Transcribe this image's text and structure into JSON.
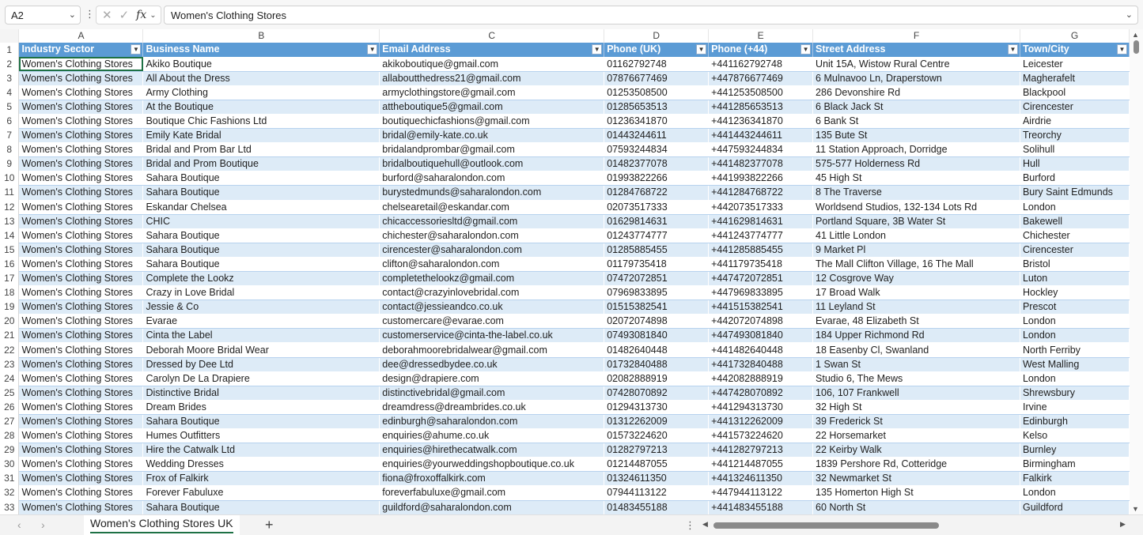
{
  "name_box": "A2",
  "formula_value": "Women's Clothing Stores",
  "columns": [
    "A",
    "B",
    "C",
    "D",
    "E",
    "F",
    "G"
  ],
  "headers": [
    "Industry Sector",
    "Business Name",
    "Email Address",
    "Phone (UK)",
    "Phone (+44)",
    "Street Address",
    "Town/City"
  ],
  "header_row_number": "1",
  "rows": [
    {
      "n": "2",
      "c": [
        "Women's Clothing Stores",
        "Akiko Boutique",
        "akikoboutique@gmail.com",
        "01162792748",
        "+441162792748",
        "Unit 15A, Wistow Rural Centre",
        "Leicester"
      ]
    },
    {
      "n": "3",
      "c": [
        "Women's Clothing Stores",
        "All About the Dress",
        "allaboutthedress21@gmail.com",
        "07876677469",
        "+447876677469",
        "6 Mulnavoo Ln, Draperstown",
        "Magherafelt"
      ]
    },
    {
      "n": "4",
      "c": [
        "Women's Clothing Stores",
        "Army Clothing",
        "armyclothingstore@gmail.com",
        "01253508500",
        "+441253508500",
        "286 Devonshire Rd",
        "Blackpool"
      ]
    },
    {
      "n": "5",
      "c": [
        "Women's Clothing Stores",
        "At the Boutique",
        "attheboutique5@gmail.com",
        "01285653513",
        "+441285653513",
        "6 Black Jack St",
        "Cirencester"
      ]
    },
    {
      "n": "6",
      "c": [
        "Women's Clothing Stores",
        "Boutique Chic Fashions Ltd",
        "boutiquechicfashions@gmail.com",
        "01236341870",
        "+441236341870",
        "6 Bank St",
        "Airdrie"
      ]
    },
    {
      "n": "7",
      "c": [
        "Women's Clothing Stores",
        "Emily Kate Bridal",
        "bridal@emily-kate.co.uk",
        "01443244611",
        "+441443244611",
        "135 Bute St",
        "Treorchy"
      ]
    },
    {
      "n": "8",
      "c": [
        "Women's Clothing Stores",
        "Bridal and Prom Bar Ltd",
        "bridalandprombar@gmail.com",
        "07593244834",
        "+447593244834",
        "11 Station Approach, Dorridge",
        "Solihull"
      ]
    },
    {
      "n": "9",
      "c": [
        "Women's Clothing Stores",
        "Bridal and Prom Boutique",
        "bridalboutiquehull@outlook.com",
        "01482377078",
        "+441482377078",
        "575-577 Holderness Rd",
        "Hull"
      ]
    },
    {
      "n": "10",
      "c": [
        "Women's Clothing Stores",
        "Sahara Boutique",
        "burford@saharalondon.com",
        "01993822266",
        "+441993822266",
        "45 High St",
        "Burford"
      ]
    },
    {
      "n": "11",
      "c": [
        "Women's Clothing Stores",
        "Sahara Boutique",
        "burystedmunds@saharalondon.com",
        "01284768722",
        "+441284768722",
        "8 The Traverse",
        "Bury Saint Edmunds"
      ]
    },
    {
      "n": "12",
      "c": [
        "Women's Clothing Stores",
        "Eskandar Chelsea",
        "chelsearetail@eskandar.com",
        "02073517333",
        "+442073517333",
        "Worldsend Studios, 132-134 Lots Rd",
        "London"
      ]
    },
    {
      "n": "13",
      "c": [
        "Women's Clothing Stores",
        "CHIC",
        "chicaccessoriesltd@gmail.com",
        "01629814631",
        "+441629814631",
        "Portland Square, 3B Water St",
        "Bakewell"
      ]
    },
    {
      "n": "14",
      "c": [
        "Women's Clothing Stores",
        "Sahara Boutique",
        "chichester@saharalondon.com",
        "01243774777",
        "+441243774777",
        "41 Little London",
        "Chichester"
      ]
    },
    {
      "n": "15",
      "c": [
        "Women's Clothing Stores",
        "Sahara Boutique",
        "cirencester@saharalondon.com",
        "01285885455",
        "+441285885455",
        "9 Market Pl",
        "Cirencester"
      ]
    },
    {
      "n": "16",
      "c": [
        "Women's Clothing Stores",
        "Sahara Boutique",
        "clifton@saharalondon.com",
        "01179735418",
        "+441179735418",
        "The Mall Clifton Village, 16 The Mall",
        "Bristol"
      ]
    },
    {
      "n": "17",
      "c": [
        "Women's Clothing Stores",
        "Complete the Lookz",
        "completethelookz@gmail.com",
        "07472072851",
        "+447472072851",
        "12 Cosgrove Way",
        "Luton"
      ]
    },
    {
      "n": "18",
      "c": [
        "Women's Clothing Stores",
        "Crazy in Love Bridal",
        "contact@crazyinlovebridal.com",
        "07969833895",
        "+447969833895",
        "17 Broad Walk",
        "Hockley"
      ]
    },
    {
      "n": "19",
      "c": [
        "Women's Clothing Stores",
        "Jessie & Co",
        "contact@jessieandco.co.uk",
        "01515382541",
        "+441515382541",
        "11 Leyland St",
        "Prescot"
      ]
    },
    {
      "n": "20",
      "c": [
        "Women's Clothing Stores",
        "Evarae",
        "customercare@evarae.com",
        "02072074898",
        "+442072074898",
        "Evarae, 48 Elizabeth St",
        "London"
      ]
    },
    {
      "n": "21",
      "c": [
        "Women's Clothing Stores",
        "Cinta the Label",
        "customerservice@cinta-the-label.co.uk",
        "07493081840",
        "+447493081840",
        "184 Upper Richmond Rd",
        "London"
      ]
    },
    {
      "n": "22",
      "c": [
        "Women's Clothing Stores",
        "Deborah Moore Bridal Wear",
        "deborahmoorebridalwear@gmail.com",
        "01482640448",
        "+441482640448",
        "18 Easenby Cl, Swanland",
        "North Ferriby"
      ]
    },
    {
      "n": "23",
      "c": [
        "Women's Clothing Stores",
        "Dressed by Dee Ltd",
        "dee@dressedbydee.co.uk",
        "01732840488",
        "+441732840488",
        "1 Swan St",
        "West Malling"
      ]
    },
    {
      "n": "24",
      "c": [
        "Women's Clothing Stores",
        "Carolyn De La Drapiere",
        "design@drapiere.com",
        "02082888919",
        "+442082888919",
        "Studio 6, The Mews",
        "London"
      ]
    },
    {
      "n": "25",
      "c": [
        "Women's Clothing Stores",
        "Distinctive Bridal",
        "distinctivebridal@gmail.com",
        "07428070892",
        "+447428070892",
        "106, 107 Frankwell",
        "Shrewsbury"
      ]
    },
    {
      "n": "26",
      "c": [
        "Women's Clothing Stores",
        "Dream Brides",
        "dreamdress@dreambrides.co.uk",
        "01294313730",
        "+441294313730",
        "32 High St",
        "Irvine"
      ]
    },
    {
      "n": "27",
      "c": [
        "Women's Clothing Stores",
        "Sahara Boutique",
        "edinburgh@saharalondon.com",
        "01312262009",
        "+441312262009",
        "39 Frederick St",
        "Edinburgh"
      ]
    },
    {
      "n": "28",
      "c": [
        "Women's Clothing Stores",
        "Humes Outfitters",
        "enquiries@ahume.co.uk",
        "01573224620",
        "+441573224620",
        "22 Horsemarket",
        "Kelso"
      ]
    },
    {
      "n": "29",
      "c": [
        "Women's Clothing Stores",
        "Hire the Catwalk Ltd",
        "enquiries@hirethecatwalk.com",
        "01282797213",
        "+441282797213",
        "22 Keirby Walk",
        "Burnley"
      ]
    },
    {
      "n": "30",
      "c": [
        "Women's Clothing Stores",
        "Wedding Dresses",
        "enquiries@yourweddingshopboutique.co.uk",
        "01214487055",
        "+441214487055",
        "1839 Pershore Rd, Cotteridge",
        "Birmingham"
      ]
    },
    {
      "n": "31",
      "c": [
        "Women's Clothing Stores",
        "Frox of Falkirk",
        "fiona@froxoffalkirk.com",
        "01324611350",
        "+441324611350",
        "32 Newmarket St",
        "Falkirk"
      ]
    },
    {
      "n": "32",
      "c": [
        "Women's Clothing Stores",
        "Forever Fabuluxe",
        "foreverfabuluxe@gmail.com",
        "07944113122",
        "+447944113122",
        "135 Homerton High St",
        "London"
      ]
    },
    {
      "n": "33",
      "c": [
        "Women's Clothing Stores",
        "Sahara Boutique",
        "guildford@saharalondon.com",
        "01483455188",
        "+441483455188",
        "60 North St",
        "Guildford"
      ]
    }
  ],
  "sheet_tab": "Women's Clothing Stores UK",
  "icons": {
    "cancel": "✕",
    "confirm": "✓",
    "fx": "fx",
    "add_sheet": "+",
    "scroll_up": "▲",
    "scroll_down": "▼",
    "scroll_left": "◀",
    "scroll_right": "▶",
    "prev_sheet": "‹",
    "next_sheet": "›",
    "more": "⋮",
    "dropdown": "⌄",
    "filter": "▼"
  },
  "colors": {
    "header_fill": "#5b9bd5",
    "band_fill": "#ddebf7",
    "tab_accent": "#1e7145"
  }
}
